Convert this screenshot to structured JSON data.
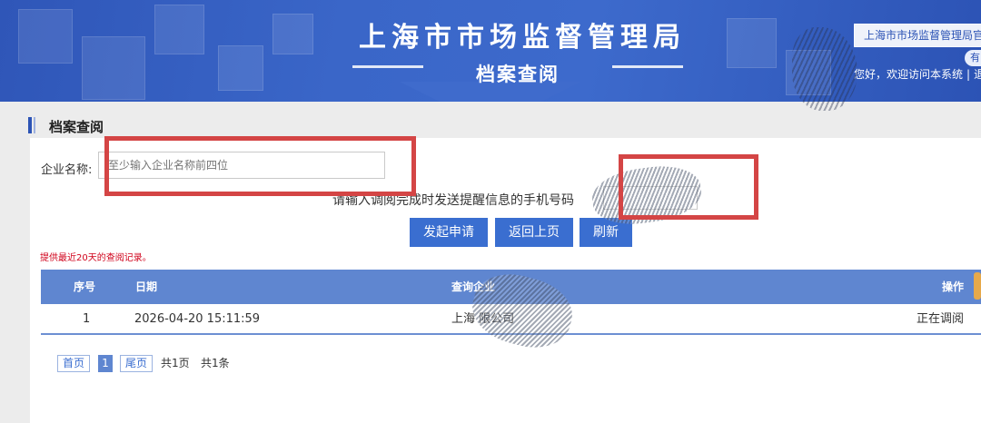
{
  "header": {
    "title": "上海市市场监督管理局",
    "subtitle": "档案查阅",
    "site_link": "上海市市场监督管理局官网",
    "pill": "有",
    "welcome_text": "您好，欢迎访问本系统",
    "welcome_sep": "|",
    "logout_fragment": "退"
  },
  "section": {
    "title": "档案查阅"
  },
  "form": {
    "company_label": "企业名称:",
    "company_placeholder": "至少输入企业名称前四位",
    "phone_label": "请输入调阅完成时发送提醒信息的手机号码",
    "phone_value": ""
  },
  "buttons": {
    "submit": "发起申请",
    "back": "返回上页",
    "refresh": "刷新"
  },
  "notice": "提供最近20天的查阅记录。",
  "table": {
    "columns": [
      "序号",
      "日期",
      "查询企业",
      "操作"
    ],
    "rows": [
      {
        "index": "1",
        "date": "2026-04-20 15:11:59",
        "company": "上海                限公司",
        "status": "正在调阅"
      }
    ]
  },
  "pagination": {
    "first": "首页",
    "current": "1",
    "last": "尾页",
    "total_pages": "共1页",
    "total_records": "共1条"
  },
  "colors": {
    "banner": "#3a66c8",
    "button": "#3a6ed0",
    "table_header": "#5f86d0",
    "annotation": "#d44545",
    "notice": "#d0021b"
  }
}
